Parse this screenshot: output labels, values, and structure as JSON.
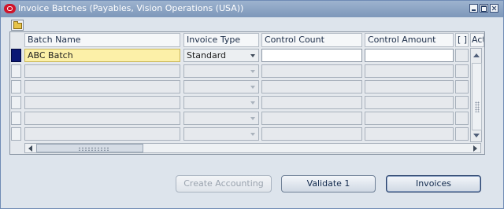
{
  "window": {
    "title": "Invoice Batches (Payables, Vision Operations (USA))",
    "controls": [
      "minimize-icon",
      "maximize-icon",
      "close-icon"
    ]
  },
  "toolbar": {
    "folder_icon": "folder-open-icon"
  },
  "table": {
    "columns": [
      "Batch Name",
      "Invoice Type",
      "Control Count",
      "Control Amount",
      "[ ]",
      "Act"
    ],
    "rows": [
      {
        "batch_name": "ABC Batch",
        "invoice_type": "Standard",
        "control_count": "",
        "control_amount": ""
      },
      {
        "batch_name": "",
        "invoice_type": "",
        "control_count": "",
        "control_amount": ""
      },
      {
        "batch_name": "",
        "invoice_type": "",
        "control_count": "",
        "control_amount": ""
      },
      {
        "batch_name": "",
        "invoice_type": "",
        "control_count": "",
        "control_amount": ""
      },
      {
        "batch_name": "",
        "invoice_type": "",
        "control_count": "",
        "control_amount": ""
      },
      {
        "batch_name": "",
        "invoice_type": "",
        "control_count": "",
        "control_amount": ""
      }
    ]
  },
  "buttons": {
    "create_accounting": "Create Accounting",
    "validate": "Validate 1",
    "invoices": "Invoices"
  },
  "colors": {
    "title_bar": "#7d97ba",
    "window_bg": "#dde4ec",
    "current_record_indicator": "#0b1774",
    "current_field": "#fcf0a8"
  }
}
